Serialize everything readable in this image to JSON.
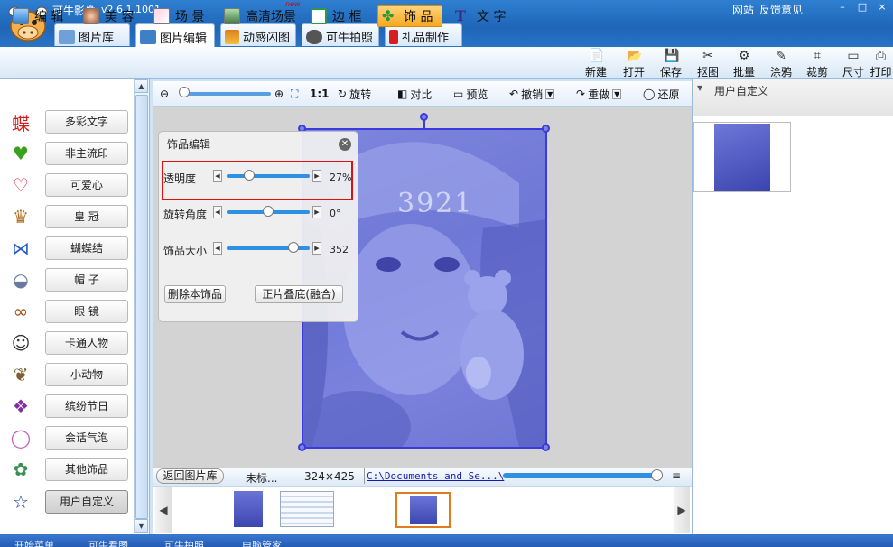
{
  "app": {
    "title": "可牛影像",
    "version": "v2.6.1.1001",
    "links": [
      "网站",
      "反馈意见"
    ],
    "window_buttons": [
      "–",
      "□",
      "×"
    ]
  },
  "main_tabs": [
    {
      "label": "图片库",
      "icon": "image-library-icon",
      "color": "#6fa0d8"
    },
    {
      "label": "图片编辑",
      "icon": "image-edit-icon",
      "color": "#3f7fc8"
    },
    {
      "label": "动感闪图",
      "icon": "flash-gif-icon",
      "color": "#e07b20"
    },
    {
      "label": "可牛拍照",
      "icon": "camera-icon",
      "color": "#555555"
    },
    {
      "label": "礼品制作",
      "icon": "gift-icon",
      "color": "#d42020"
    }
  ],
  "edit_tools": [
    {
      "label": "编 辑",
      "icon": "edit-icon"
    },
    {
      "label": "美 容",
      "icon": "beauty-icon"
    },
    {
      "label": "场 景",
      "icon": "scene-icon"
    },
    {
      "label": "高清场景",
      "icon": "hd-scene-icon",
      "badge": "new"
    },
    {
      "label": "边 框",
      "icon": "frame-icon"
    },
    {
      "label": "饰 品",
      "icon": "ornament-icon"
    },
    {
      "label": "文 字",
      "icon": "text-icon"
    }
  ],
  "actions": [
    {
      "label": "新建",
      "glyph": "📄"
    },
    {
      "label": "打开",
      "glyph": "📂"
    },
    {
      "label": "保存",
      "glyph": "💾"
    },
    {
      "label": "抠图",
      "glyph": "✂"
    },
    {
      "label": "批量",
      "glyph": "⚙"
    },
    {
      "label": "涂鸦",
      "glyph": "✎"
    },
    {
      "label": "裁剪",
      "glyph": "⌗"
    },
    {
      "label": "尺寸",
      "glyph": "▭"
    },
    {
      "label": "打印",
      "glyph": "⎙"
    }
  ],
  "categories": [
    {
      "label": "多彩文字",
      "glyph": "蝶",
      "color": "#d02020"
    },
    {
      "label": "非主流印",
      "glyph": "♥",
      "color": "#3aa020"
    },
    {
      "label": "可爱心",
      "glyph": "♡",
      "color": "#e02030"
    },
    {
      "label": "皇 冠",
      "glyph": "♛",
      "color": "#b07020"
    },
    {
      "label": "蝴蝶结",
      "glyph": "⋈",
      "color": "#2a60c0"
    },
    {
      "label": "帽 子",
      "glyph": "◒",
      "color": "#6a7aa0"
    },
    {
      "label": "眼 镜",
      "glyph": "∞",
      "color": "#a05010"
    },
    {
      "label": "卡通人物",
      "glyph": "☺",
      "color": "#333333"
    },
    {
      "label": "小动物",
      "glyph": "❦",
      "color": "#806030"
    },
    {
      "label": "缤纷节日",
      "glyph": "❖",
      "color": "#8030a0"
    },
    {
      "label": "会话气泡",
      "glyph": "◯",
      "color": "#c060c0"
    },
    {
      "label": "其他饰品",
      "glyph": "✿",
      "color": "#3a9050"
    },
    {
      "label": "用户自定义",
      "glyph": "☆",
      "color": "#1a3fa0"
    }
  ],
  "canvas_toolbar": {
    "ratio": "1:1",
    "rotate": "旋转",
    "compare": "对比",
    "preview": "预览",
    "undo": "撤销",
    "redo": "重做",
    "restore": "还原"
  },
  "panel": {
    "title": "饰品编辑",
    "opacity_label": "透明度",
    "opacity_value": "27%",
    "opacity_fraction": 0.27,
    "rotation_label": "旋转角度",
    "rotation_value": "0°",
    "size_label": "饰品大小",
    "size_value": "352",
    "delete_button": "删除本饰品",
    "blend_button": "正片叠底(融合)"
  },
  "photo_text": "3921",
  "status": {
    "back": "返回图片库",
    "name": "未标...",
    "dimensions": "324×425",
    "path": "C:\\Documents and Se...\\"
  },
  "right_panel": {
    "title": "用户自定义"
  },
  "taskbar": [
    "开始菜单",
    "可牛看图",
    "可牛拍照",
    "电脑管家"
  ]
}
